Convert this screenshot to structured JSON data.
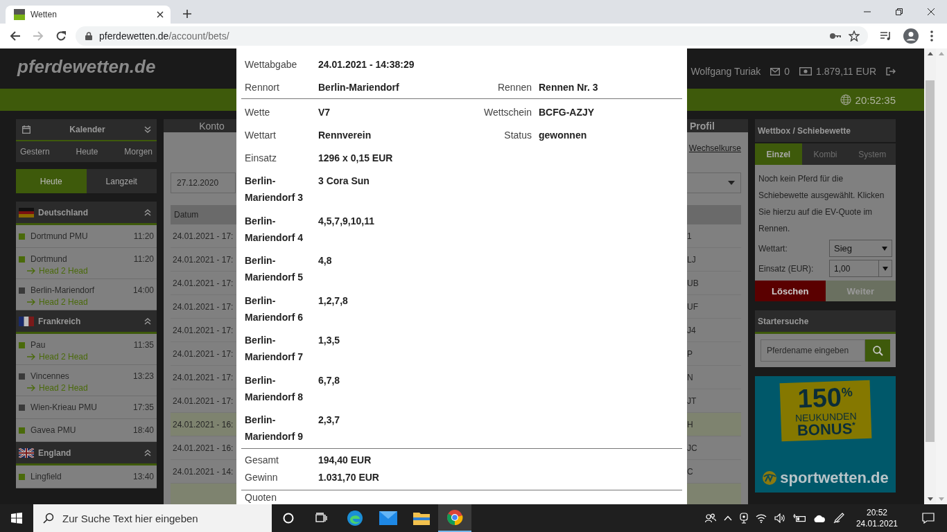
{
  "browser": {
    "tab": {
      "title": "Wetten"
    },
    "url": {
      "host": "pferdewetten.de",
      "path": "/account/bets/"
    }
  },
  "header": {
    "logo": "pferdewetten.de",
    "user": "Wolfgang Turiak",
    "messages": "0",
    "balance": "1.879,11 EUR",
    "clock": "20:52:35"
  },
  "calendar": {
    "title": "Kalender",
    "days": [
      "Gestern",
      "Heute",
      "Morgen"
    ]
  },
  "range_tabs": [
    {
      "label": "Heute",
      "selected": true
    },
    {
      "label": "Langzeit",
      "selected": false
    }
  ],
  "countries": [
    {
      "name": "Deutschland",
      "kind": "de",
      "expanded": true,
      "races": [
        {
          "name": "Dortmund PMU",
          "time": "11:20",
          "color": "#4a6a0a"
        },
        {
          "name": "Dortmund",
          "time": "11:20",
          "color": "#4a6a0a",
          "link": "Head 2 Head"
        },
        {
          "name": "Berlin-Mariendorf",
          "time": "14:00",
          "color": "#3a3a3a",
          "link": "Head 2 Head"
        }
      ]
    },
    {
      "name": "Frankreich",
      "kind": "fr",
      "expanded": true,
      "races": [
        {
          "name": "Pau",
          "time": "11:35",
          "color": "#4a6a0a",
          "link": "Head 2 Head"
        },
        {
          "name": "Vincennes",
          "time": "13:23",
          "color": "#3a3a3a",
          "link": "Head 2 Head"
        },
        {
          "name": "Wien-Krieau PMU",
          "time": "17:35",
          "color": "#3a3a3a"
        },
        {
          "name": "Gavea PMU",
          "time": "18:40",
          "color": "#4a6a0a"
        }
      ]
    },
    {
      "name": "England",
      "kind": "gb",
      "expanded": true,
      "races": [
        {
          "name": "Lingfield",
          "time": "13:40",
          "color": "#4a6a0a"
        }
      ]
    }
  ],
  "account": {
    "tabs": [
      {
        "label": "Konto"
      },
      {
        "label": "Profil"
      }
    ],
    "link": "Wechselkurse",
    "date_from": "27.12.2020",
    "table": {
      "columns": [
        "Datum"
      ],
      "rows": [
        {
          "date": "24.01.2021 - 17:",
          "column_2": "1",
          "highlighted": false
        },
        {
          "date": "24.01.2021 - 17:",
          "column_2": "LJ",
          "highlighted": false
        },
        {
          "date": "24.01.2021 - 17:",
          "column_2": "UB",
          "highlighted": false
        },
        {
          "date": "24.01.2021 - 17:",
          "column_2": "UF",
          "highlighted": false
        },
        {
          "date": "24.01.2021 - 17:",
          "column_2": "J4",
          "highlighted": false
        },
        {
          "date": "24.01.2021 - 17:",
          "column_2": "P",
          "highlighted": false
        },
        {
          "date": "24.01.2021 - 17:",
          "column_2": "N",
          "highlighted": false
        },
        {
          "date": "24.01.2021 - 17:",
          "column_2": "JT",
          "highlighted": false
        },
        {
          "date": "24.01.2021 - 16:",
          "column_2": "H",
          "highlighted": true
        },
        {
          "date": "24.01.2021 - 16:",
          "column_2": "JC",
          "highlighted": false
        },
        {
          "date": "24.01.2021 - 14:",
          "column_2": "C",
          "highlighted": false
        },
        {
          "highlighted": true
        }
      ]
    }
  },
  "bet_slip": {
    "title": "Wettbox / Schiebewette",
    "tabs": [
      {
        "label": "Einzel",
        "selected": true
      },
      {
        "label": "Kombi",
        "selected": false
      },
      {
        "label": "System",
        "selected": false
      }
    ],
    "message": "Noch kein Pferd für die Schiebewette ausgewählt. Klicken Sie hierzu auf die EV-Quote im Rennen.",
    "fields": [
      {
        "label": "Wettart:",
        "value": "Sieg",
        "kind": "select"
      },
      {
        "label": "Einsatz (EUR):",
        "value": "1,00",
        "kind": "combo"
      }
    ],
    "buttons": [
      {
        "label": "Löschen",
        "kind": "danger",
        "disabled": false
      },
      {
        "label": "Weiter",
        "kind": "primary",
        "disabled": true
      }
    ]
  },
  "starter_search": {
    "title": "Startersuche",
    "placeholder": "Pferdename eingeben"
  },
  "ad": {
    "headline": "150$^{%}$",
    "line_1": "NEUKUNDEN",
    "line_2": "BONUS$^{*}$",
    "brand": "sport**wetten**.de"
  },
  "bet_detail": {
    "sections": [
      {
        "rows": [
          {
            "kind": "pair",
            "fields": [
              {
                "label": "Wettabgabe",
                "value": "24.01.2021 - 14:38:29"
              }
            ]
          },
          {
            "kind": "pair",
            "fields": [
              {
                "label": "Rennort",
                "value": "Berlin-Mariendorf"
              },
              {
                "label": "Rennen",
                "value": "Rennen Nr. 3"
              }
            ]
          }
        ]
      },
      {
        "rows": [
          {
            "kind": "pair",
            "fields": [
              {
                "label": "Wette",
                "value": "V7"
              },
              {
                "label": "Wettschein",
                "value": "BCFG-AZJY"
              }
            ]
          },
          {
            "kind": "pair",
            "fields": [
              {
                "label": "Wettart",
                "value": "Rennverein"
              },
              {
                "label": "Status",
                "value": "gewonnen"
              }
            ]
          },
          {
            "kind": "pair",
            "fields": [
              {
                "label": "Einsatz",
                "value": "1296 x 0,15 EUR"
              }
            ]
          },
          {
            "kind": "leg",
            "label": "Berlin-Mariendorf 3",
            "value": "3 Cora Sun"
          },
          {
            "kind": "leg",
            "label": "Berlin-Mariendorf 4",
            "value": "4,5,7,9,10,11"
          },
          {
            "kind": "leg",
            "label": "Berlin-Mariendorf 5",
            "value": "4,8"
          },
          {
            "kind": "leg",
            "label": "Berlin-Mariendorf 6",
            "value": "1,2,7,8"
          },
          {
            "kind": "leg",
            "label": "Berlin-Mariendorf 7",
            "value": "1,3,5"
          },
          {
            "kind": "leg",
            "label": "Berlin-Mariendorf 8",
            "value": "6,7,8"
          },
          {
            "kind": "leg",
            "label": "Berlin-Mariendorf 9",
            "value": "2,3,7"
          }
        ]
      },
      {
        "rows": [
          {
            "kind": "total",
            "label": "Gesamt",
            "value": "194,40 EUR"
          },
          {
            "kind": "total",
            "label": "Gewinn",
            "value": "1.031,70 EUR"
          }
        ]
      },
      {
        "rows": [
          {
            "kind": "total",
            "label": "Quoten"
          }
        ]
      }
    ]
  },
  "taskbar": {
    "search_placeholder": "Zur Suche Text hier eingeben",
    "time": "20:52",
    "date": "24.01.2021"
  }
}
